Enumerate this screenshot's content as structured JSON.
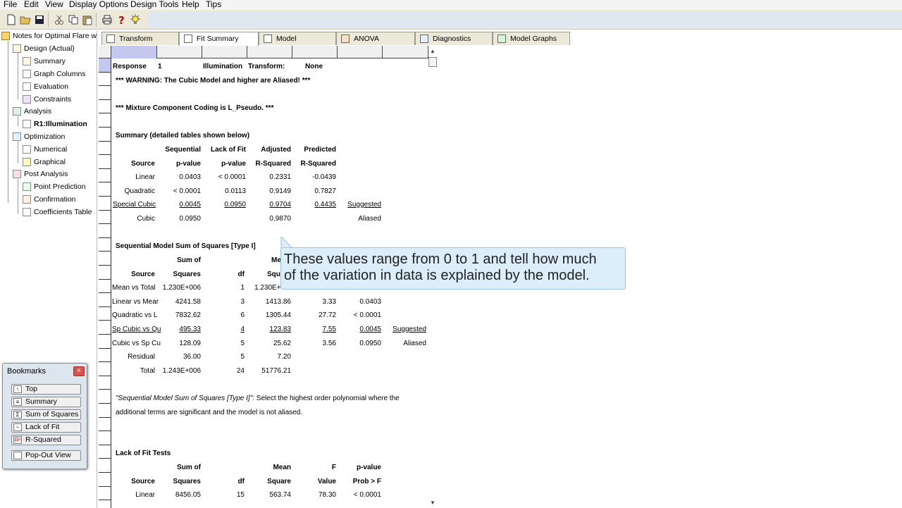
{
  "menu": [
    "File",
    "Edit",
    "View",
    "Display Options",
    "Design Tools",
    "Help",
    "Tips"
  ],
  "toolbar_icons": [
    "new-icon",
    "open-icon",
    "save-icon",
    "cut-icon",
    "copy-icon",
    "paste-icon",
    "print-icon",
    "help-icon",
    "tip-bulb-icon"
  ],
  "tree": {
    "root": "Notes for Optimal Flare wit",
    "design": "Design (Actual)",
    "summary": "Summary",
    "graph_columns": "Graph Columns",
    "evaluation": "Evaluation",
    "constraints": "Constraints",
    "analysis": "Analysis",
    "r1": "R1:Illumination",
    "optimization": "Optimization",
    "numerical": "Numerical",
    "graphical": "Graphical",
    "post_analysis": "Post Analysis",
    "point_prediction": "Point Prediction",
    "confirmation": "Confirmation",
    "coefficients_table": "Coefficients Table"
  },
  "bookmarks": {
    "title": "Bookmarks",
    "items": [
      "Top",
      "Summary",
      "Sum of Squares",
      "Lack of Fit",
      "R-Squared"
    ],
    "popout": "Pop-Out View",
    "icon_glyphs": [
      "↑",
      "≡",
      "Σ",
      "~",
      "R²"
    ]
  },
  "tabs": [
    "Transform",
    "Fit Summary",
    "Model",
    "ANOVA",
    "Diagnostics",
    "Model Graphs"
  ],
  "report": {
    "response_label": "Response",
    "response_num": "1",
    "response_name": "Illumination",
    "transform_label": "Transform:",
    "transform_value": "None",
    "warning": "*** WARNING:  The Cubic Model and higher are Aliased! ***",
    "coding": "*** Mixture Component Coding is L_Pseudo. ***",
    "summary_title": "Summary (detailed tables shown below)",
    "summary_headers1": [
      "Sequential",
      "Lack of Fit",
      "Adjusted",
      "Predicted"
    ],
    "summary_headers2": [
      "Source",
      "p-value",
      "p-value",
      "R-Squared",
      "R-Squared"
    ],
    "summary_rows": [
      {
        "source": "Linear",
        "seq": "0.0403",
        "lof": "< 0.0001",
        "adj": "0.2331",
        "pred": "-0.0439",
        "note": ""
      },
      {
        "source": "Quadratic",
        "seq": "< 0.0001",
        "lof": "0.0113",
        "adj": "0.9149",
        "pred": "0.7827",
        "note": ""
      },
      {
        "source": "Special Cubic",
        "seq": "0.0045",
        "lof": "0.0950",
        "adj": "0.9704",
        "pred": "0.4435",
        "note": "Suggested"
      },
      {
        "source": "Cubic",
        "seq": "0.0950",
        "lof": "",
        "adj": "0.9870",
        "pred": "",
        "note": "Aliased"
      }
    ],
    "seq_title": "Sequential Model Sum of Squares [Type I]",
    "seq_headers1": [
      "Sum of",
      "Me"
    ],
    "seq_headers2": [
      "Source",
      "Squares",
      "df",
      "Squa"
    ],
    "seq_rows": [
      {
        "source": "Mean vs Total",
        "ss": "1.230E+006",
        "df": "1",
        "ms": "1.230E+0",
        "f": "",
        "p": "",
        "note": ""
      },
      {
        "source": "Linear vs Mear",
        "ss": "4241.58",
        "df": "3",
        "ms": "1413.86",
        "f": "3.33",
        "p": "0.0403",
        "note": ""
      },
      {
        "source": "Quadratic vs L",
        "ss": "7832.62",
        "df": "6",
        "ms": "1305.44",
        "f": "27.72",
        "p": "< 0.0001",
        "note": ""
      },
      {
        "source": "Sp Cubic vs Qu",
        "ss": "495.33",
        "df": "4",
        "ms": "123.83",
        "f": "7.55",
        "p": "0.0045",
        "note": "Suggested"
      },
      {
        "source": "Cubic vs Sp Cu",
        "ss": "128.09",
        "df": "5",
        "ms": "25.62",
        "f": "3.56",
        "p": "0.0950",
        "note": "Aliased"
      },
      {
        "source": "Residual",
        "ss": "36.00",
        "df": "5",
        "ms": "7.20",
        "f": "",
        "p": "",
        "note": ""
      },
      {
        "source": "Total",
        "ss": "1.243E+006",
        "df": "24",
        "ms": "51776.21",
        "f": "",
        "p": "",
        "note": ""
      }
    ],
    "note_prefix": "\"Sequential Model Sum of Squares [Type I]\":",
    "note_line1_rest": "  Select the highest order polynomial where the",
    "note_line2": "additional terms are significant and the model is not aliased.",
    "lof_title": "Lack of Fit Tests",
    "lof_headers1": [
      "Sum of",
      "Mean",
      "F",
      "p-value"
    ],
    "lof_headers2": [
      "Source",
      "Squares",
      "df",
      "Square",
      "Value",
      "Prob > F"
    ],
    "lof_rows": [
      {
        "source": "Linear",
        "ss": "8456.05",
        "df": "15",
        "ms": "563.74",
        "f": "78.30",
        "p": "< 0.0001"
      }
    ]
  },
  "callout": {
    "line1": "These values range from 0 to 1 and tell how much",
    "line2": "of the variation in data is explained by the model."
  }
}
